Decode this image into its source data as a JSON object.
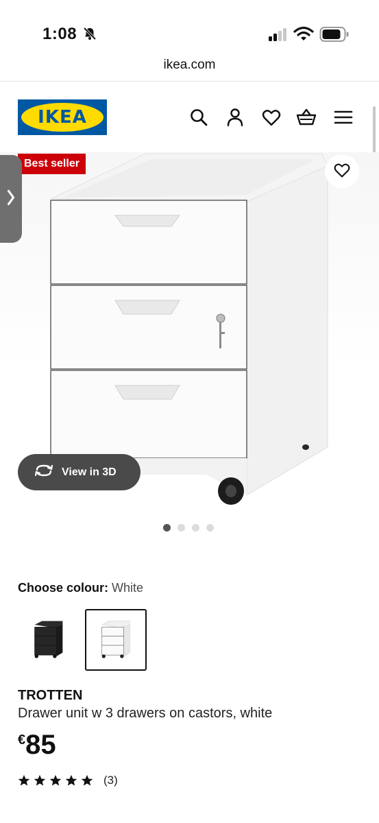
{
  "status_bar": {
    "time": "1:08"
  },
  "browser": {
    "url": "ikea.com"
  },
  "header": {
    "logo_text": "IKEA"
  },
  "product": {
    "badge": "Best seller",
    "view_3d_label": "View in 3D",
    "choose_colour_label": "Choose colour:",
    "selected_colour": "White",
    "name": "TROTTEN",
    "description": "Drawer unit w 3 drawers on castors, white",
    "price_currency": "€",
    "price_value": "85",
    "rating_stars": 5,
    "rating_count": "(3)",
    "image_page": 1,
    "image_page_count": 4
  },
  "colors": {
    "ikea_blue": "#0058a3",
    "ikea_yellow": "#ffdb00",
    "badge_red": "#cc0008"
  }
}
